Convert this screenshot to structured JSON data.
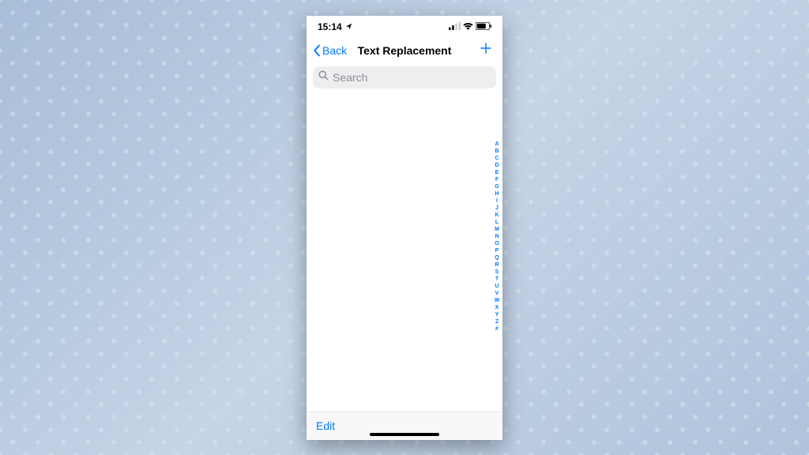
{
  "statusBar": {
    "time": "15:14"
  },
  "nav": {
    "backLabel": "Back",
    "title": "Text Replacement"
  },
  "search": {
    "placeholder": "Search"
  },
  "indexLetters": [
    "A",
    "B",
    "C",
    "D",
    "E",
    "F",
    "G",
    "H",
    "I",
    "J",
    "K",
    "L",
    "M",
    "N",
    "O",
    "P",
    "Q",
    "R",
    "S",
    "T",
    "U",
    "V",
    "W",
    "X",
    "Y",
    "Z",
    "#"
  ],
  "toolbar": {
    "editLabel": "Edit"
  }
}
